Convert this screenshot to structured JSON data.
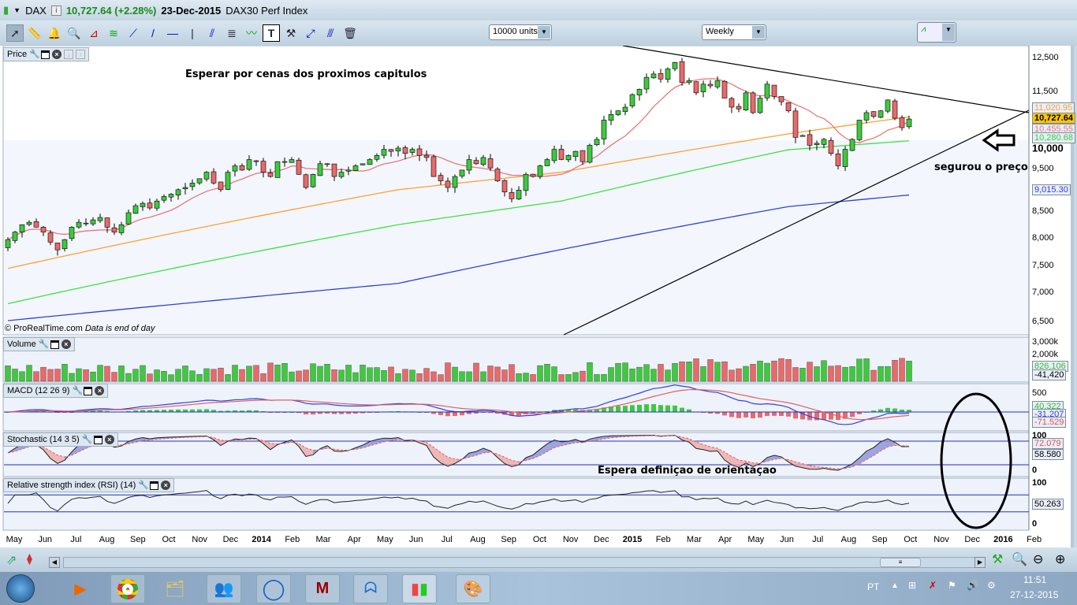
{
  "titlebar": {
    "symbol": "DAX",
    "price": "10,727.64 (+2.28%)",
    "date": "23-Dec-2015",
    "name": "DAX30 Perf Index"
  },
  "toolbar": {
    "units": "10000 units",
    "period": "Weekly",
    "tools": [
      "select-arrow",
      "ruler",
      "alert-bell",
      "zoom-magnifier",
      "triangle",
      "channel",
      "segment",
      "line",
      "horizontal-line",
      "vertical-line",
      "parallel-lines",
      "fibonacci",
      "trend-tool",
      "text",
      "properties",
      "arrow-line",
      "delete-trash"
    ]
  },
  "panels": {
    "price": "Price",
    "volume": "Volume",
    "macd": "MACD (12 26 9)",
    "stoch": "Stochastic (14 3 5)",
    "rsi": "Relative strength index (RSI) (14)"
  },
  "credit": "© ProRealTime.com",
  "credit_note": "Data is end of day",
  "annotations": {
    "top": "Esperar por cenas dos proximos capitulos",
    "support": "segurou o preço",
    "stoch": "Espera definiçao de orientaçao"
  },
  "price_axis": [
    "12,500",
    "11,500",
    "10,000",
    "9,500",
    "8,500",
    "8,000",
    "7,500",
    "7,000",
    "6,500"
  ],
  "price_tags": {
    "ma50": "11,020.95",
    "last": "10,727.64",
    "ma20": "10,455.55",
    "ma100": "10,280.68",
    "ma200": "9,015.30"
  },
  "volume_axis": [
    "3,000k",
    "2,000k"
  ],
  "volume_tags": {
    "vol": "826,106",
    "vol2": "-41,420"
  },
  "macd_axis": [
    "500"
  ],
  "macd_tags": {
    "macd": "40.322",
    "signal": "-31.207",
    "hist": "-71.529"
  },
  "stoch_axis": [
    "100",
    "0"
  ],
  "stoch_tags": {
    "k": "72.079",
    "d": "58.580"
  },
  "rsi_axis": [
    "100",
    "0"
  ],
  "rsi_tags": {
    "rsi": "50.263"
  },
  "months": [
    "May",
    "Jun",
    "Jul",
    "Aug",
    "Sep",
    "Oct",
    "Nov",
    "Dec",
    "2014",
    "Feb",
    "Mar",
    "Apr",
    "May",
    "Jun",
    "Jul",
    "Aug",
    "Sep",
    "Oct",
    "Nov",
    "Dec",
    "2015",
    "Feb",
    "Mar",
    "Apr",
    "May",
    "Jun",
    "Jul",
    "Aug",
    "Sep",
    "Oct",
    "Nov",
    "Dec",
    "2016",
    "Feb"
  ],
  "taskbar": {
    "lang": "PT",
    "time": "11:51",
    "date": "27-12-2015"
  },
  "colors": {
    "up": "#3ec93e",
    "down": "#e86a6a",
    "ma20": "#e87878",
    "ma50": "#ffa030",
    "ma100": "#40e040",
    "ma200": "#3040e0"
  },
  "chart_data": {
    "type": "candlestick",
    "title": "DAX30 Perf Index weekly",
    "scale": "log",
    "ylim": [
      6300,
      12900
    ],
    "weekly_close": [
      7950,
      8100,
      8250,
      8300,
      8200,
      8100,
      7900,
      7750,
      7950,
      8200,
      8300,
      8280,
      8350,
      8400,
      8200,
      8100,
      8250,
      8500,
      8650,
      8700,
      8600,
      8750,
      8850,
      8900,
      9000,
      9050,
      9150,
      9250,
      9400,
      9150,
      9000,
      9400,
      9550,
      9450,
      9700,
      9650,
      9400,
      9300,
      9650,
      9650,
      9700,
      9350,
      9050,
      9350,
      9600,
      9600,
      9300,
      9400,
      9450,
      9550,
      9600,
      9700,
      9800,
      9950,
      9900,
      9980,
      9850,
      9950,
      9800,
      9750,
      9300,
      9200,
      9050,
      9300,
      9450,
      9700,
      9600,
      9750,
      9500,
      9200,
      8950,
      8800,
      8990,
      9350,
      9300,
      9550,
      9700,
      9950,
      9700,
      9800,
      9900,
      9650,
      10050,
      10200,
      10700,
      10850,
      10950,
      11050,
      11400,
      11550,
      11900,
      12000,
      11850,
      12150,
      12350,
      11750,
      11800,
      11450,
      11700,
      11650,
      11800,
      11300,
      11050,
      11000,
      11450,
      10900,
      11300,
      11700,
      11350,
      11200,
      10950,
      10250,
      10300,
      10050,
      10100,
      10200,
      9850,
      9550,
      9950,
      10200,
      10700,
      10900,
      10800,
      10950,
      11250,
      10750,
      10500,
      10727.64
    ],
    "ma50_anchors": [
      [
        0,
        7400
      ],
      [
        55,
        9000
      ],
      [
        78,
        9400
      ],
      [
        110,
        10340
      ],
      [
        136,
        11020.95
      ]
    ],
    "ma100_anchors": [
      [
        0,
        6780
      ],
      [
        55,
        8250
      ],
      [
        78,
        8750
      ],
      [
        110,
        9940
      ],
      [
        136,
        10280.68
      ]
    ],
    "ma200_anchors": [
      [
        0,
        6500
      ],
      [
        55,
        7130
      ],
      [
        110,
        8630
      ],
      [
        136,
        9015.3
      ]
    ],
    "trendlines": [
      {
        "name": "resistance",
        "from": [
          "2015-Mar",
          12750
        ],
        "to": [
          "2016-Feb",
          11100
        ]
      },
      {
        "name": "support",
        "from": [
          "2014-Dec",
          6400
        ],
        "to": [
          "2016-Feb",
          11100
        ]
      }
    ]
  }
}
